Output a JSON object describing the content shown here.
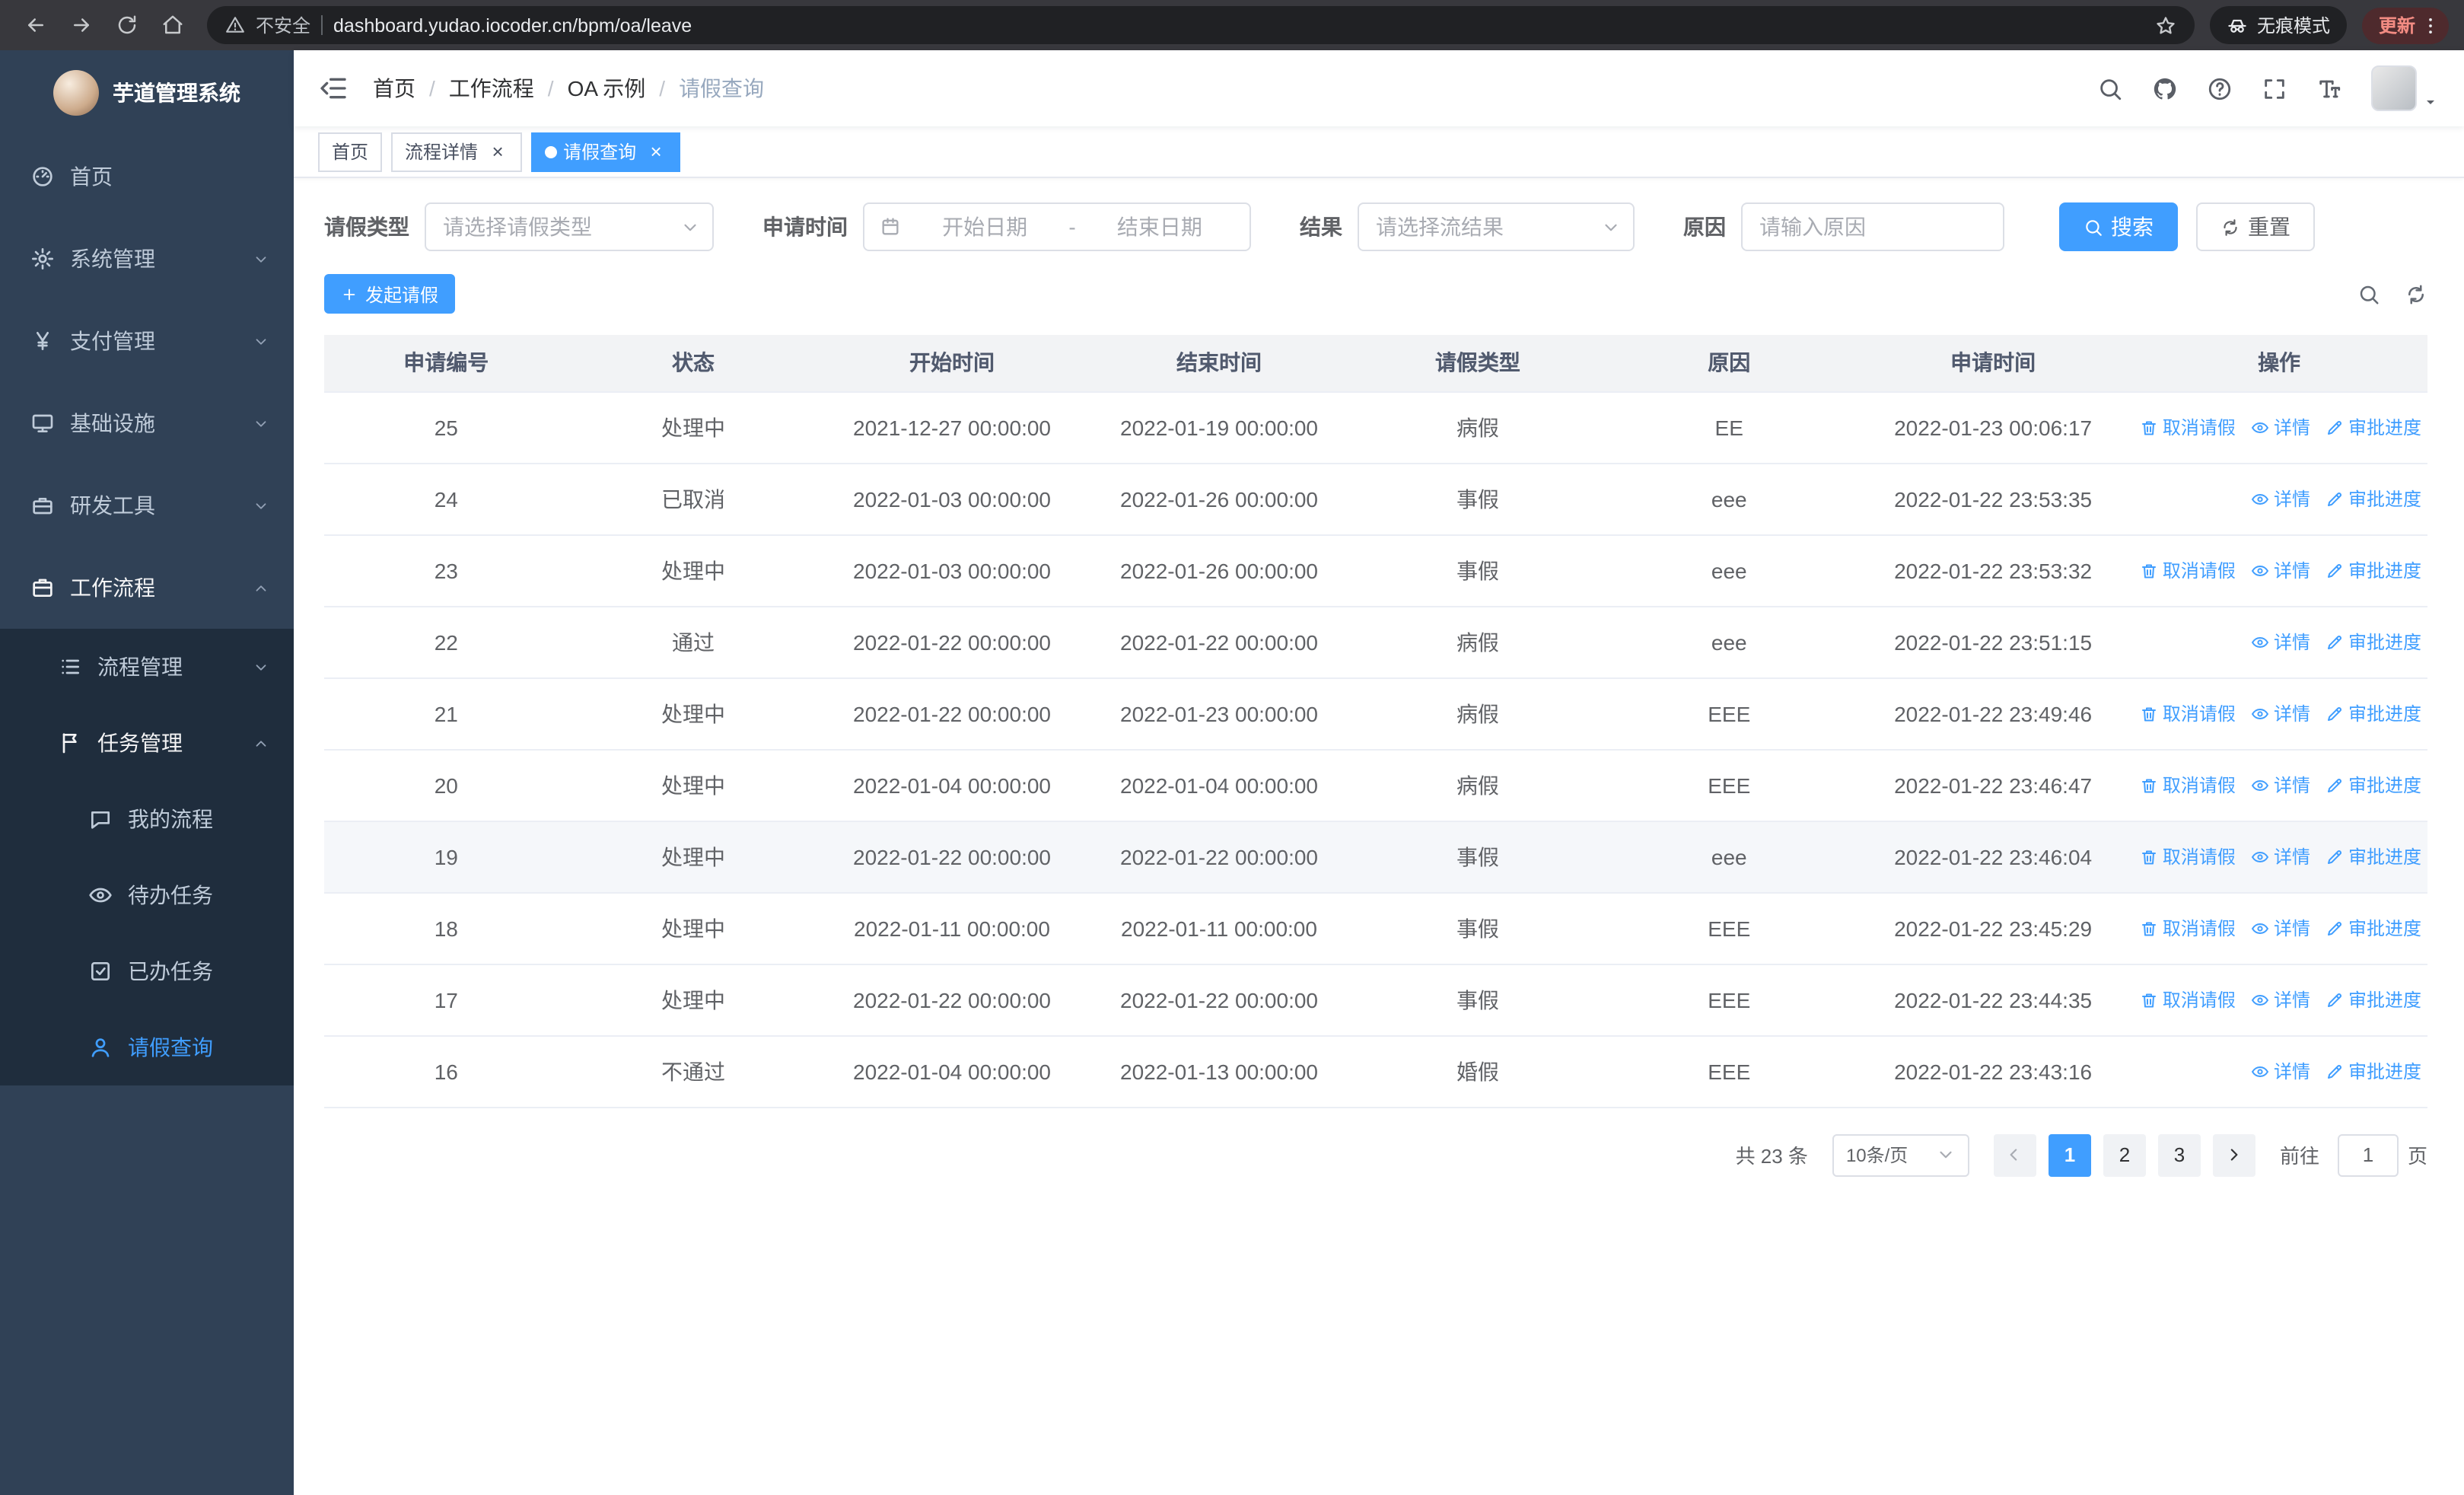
{
  "browser": {
    "security_warning": "不安全",
    "url": "dashboard.yudao.iocoder.cn/bpm/oa/leave",
    "incognito_label": "无痕模式",
    "update_label": "更新"
  },
  "sidebar": {
    "logo_title": "芋道管理系统",
    "menu": [
      {
        "name": "home",
        "label": "首页",
        "icon": "dashboard-icon",
        "level": 1
      },
      {
        "name": "system-management",
        "label": "系统管理",
        "icon": "gear-icon",
        "level": 1,
        "chevron": "down"
      },
      {
        "name": "payment-management",
        "label": "支付管理",
        "icon": "yen-icon",
        "level": 1,
        "chevron": "down"
      },
      {
        "name": "infrastructure",
        "label": "基础设施",
        "icon": "infra-icon",
        "level": 1,
        "chevron": "down"
      },
      {
        "name": "dev-tools",
        "label": "研发工具",
        "icon": "toolbox-icon",
        "level": 1,
        "chevron": "down"
      },
      {
        "name": "workflow",
        "label": "工作流程",
        "icon": "briefcase-icon",
        "level": 1,
        "chevron": "up",
        "open": true
      },
      {
        "name": "process-management",
        "label": "流程管理",
        "icon": "list-icon",
        "level": 2,
        "chevron": "down"
      },
      {
        "name": "task-management",
        "label": "任务管理",
        "icon": "flag-icon",
        "level": 2,
        "chevron": "up",
        "open": true
      },
      {
        "name": "my-process",
        "label": "我的流程",
        "icon": "chat-icon",
        "level": 3
      },
      {
        "name": "todo-tasks",
        "label": "待办任务",
        "icon": "eye-icon",
        "level": 3
      },
      {
        "name": "done-tasks",
        "label": "已办任务",
        "icon": "check-square-icon",
        "level": 3
      },
      {
        "name": "leave-query",
        "label": "请假查询",
        "icon": "user-icon",
        "level": 3,
        "active": true
      }
    ]
  },
  "header": {
    "breadcrumb": [
      "首页",
      "工作流程",
      "OA 示例",
      "请假查询"
    ],
    "tools": [
      {
        "name": "search",
        "icon": "search-icon"
      },
      {
        "name": "github",
        "icon": "github-icon"
      },
      {
        "name": "help",
        "icon": "help-icon"
      },
      {
        "name": "fullscreen",
        "icon": "fullscreen-icon"
      },
      {
        "name": "font-size",
        "icon": "font-size-icon"
      }
    ]
  },
  "tabs": [
    {
      "name": "home",
      "label": "首页",
      "closable": false,
      "active": false
    },
    {
      "name": "process-detail",
      "label": "流程详情",
      "closable": true,
      "active": false
    },
    {
      "name": "leave-query",
      "label": "请假查询",
      "closable": true,
      "active": true
    }
  ],
  "filters": {
    "leave_type_label": "请假类型",
    "leave_type_placeholder": "请选择请假类型",
    "apply_time_label": "申请时间",
    "start_date_placeholder": "开始日期",
    "date_separator": "-",
    "end_date_placeholder": "结束日期",
    "result_label": "结果",
    "result_placeholder": "请选择流结果",
    "reason_label": "原因",
    "reason_placeholder": "请输入原因",
    "search_button": "搜索",
    "reset_button": "重置"
  },
  "toolbar": {
    "create_button": "发起请假"
  },
  "table": {
    "columns": [
      "申请编号",
      "状态",
      "开始时间",
      "结束时间",
      "请假类型",
      "原因",
      "申请时间",
      "操作"
    ],
    "action_defs": {
      "cancel": {
        "label": "取消请假",
        "icon": "delete-icon"
      },
      "detail": {
        "label": "详情",
        "icon": "eye-icon"
      },
      "progress": {
        "label": "审批进度",
        "icon": "edit-icon"
      }
    },
    "rows": [
      {
        "id": "25",
        "status": "处理中",
        "start_time": "2021-12-27 00:00:00",
        "end_time": "2022-01-19 00:00:00",
        "leave_type": "病假",
        "reason": "EE",
        "apply_time": "2022-01-23 00:06:17",
        "actions": [
          "cancel",
          "detail",
          "progress"
        ]
      },
      {
        "id": "24",
        "status": "已取消",
        "start_time": "2022-01-03 00:00:00",
        "end_time": "2022-01-26 00:00:00",
        "leave_type": "事假",
        "reason": "eee",
        "apply_time": "2022-01-22 23:53:35",
        "actions": [
          "detail",
          "progress"
        ]
      },
      {
        "id": "23",
        "status": "处理中",
        "start_time": "2022-01-03 00:00:00",
        "end_time": "2022-01-26 00:00:00",
        "leave_type": "事假",
        "reason": "eee",
        "apply_time": "2022-01-22 23:53:32",
        "actions": [
          "cancel",
          "detail",
          "progress"
        ]
      },
      {
        "id": "22",
        "status": "通过",
        "start_time": "2022-01-22 00:00:00",
        "end_time": "2022-01-22 00:00:00",
        "leave_type": "病假",
        "reason": "eee",
        "apply_time": "2022-01-22 23:51:15",
        "actions": [
          "detail",
          "progress"
        ]
      },
      {
        "id": "21",
        "status": "处理中",
        "start_time": "2022-01-22 00:00:00",
        "end_time": "2022-01-23 00:00:00",
        "leave_type": "病假",
        "reason": "EEE",
        "apply_time": "2022-01-22 23:49:46",
        "actions": [
          "cancel",
          "detail",
          "progress"
        ]
      },
      {
        "id": "20",
        "status": "处理中",
        "start_time": "2022-01-04 00:00:00",
        "end_time": "2022-01-04 00:00:00",
        "leave_type": "病假",
        "reason": "EEE",
        "apply_time": "2022-01-22 23:46:47",
        "actions": [
          "cancel",
          "detail",
          "progress"
        ]
      },
      {
        "id": "19",
        "status": "处理中",
        "start_time": "2022-01-22 00:00:00",
        "end_time": "2022-01-22 00:00:00",
        "leave_type": "事假",
        "reason": "eee",
        "apply_time": "2022-01-22 23:46:04",
        "actions": [
          "cancel",
          "detail",
          "progress"
        ],
        "highlight": true
      },
      {
        "id": "18",
        "status": "处理中",
        "start_time": "2022-01-11 00:00:00",
        "end_time": "2022-01-11 00:00:00",
        "leave_type": "事假",
        "reason": "EEE",
        "apply_time": "2022-01-22 23:45:29",
        "actions": [
          "cancel",
          "detail",
          "progress"
        ]
      },
      {
        "id": "17",
        "status": "处理中",
        "start_time": "2022-01-22 00:00:00",
        "end_time": "2022-01-22 00:00:00",
        "leave_type": "事假",
        "reason": "EEE",
        "apply_time": "2022-01-22 23:44:35",
        "actions": [
          "cancel",
          "detail",
          "progress"
        ]
      },
      {
        "id": "16",
        "status": "不通过",
        "start_time": "2022-01-04 00:00:00",
        "end_time": "2022-01-13 00:00:00",
        "leave_type": "婚假",
        "reason": "EEE",
        "apply_time": "2022-01-22 23:43:16",
        "actions": [
          "detail",
          "progress"
        ]
      }
    ]
  },
  "pagination": {
    "total_text": "共 23 条",
    "page_size_label": "10条/页",
    "pages": [
      "1",
      "2",
      "3"
    ],
    "active_page": "1",
    "goto_label": "前往",
    "goto_value": "1",
    "goto_suffix": "页"
  },
  "colors": {
    "primary": "#409eff",
    "sidebar_bg": "#304156",
    "submenu_bg": "#1f2d3d"
  }
}
